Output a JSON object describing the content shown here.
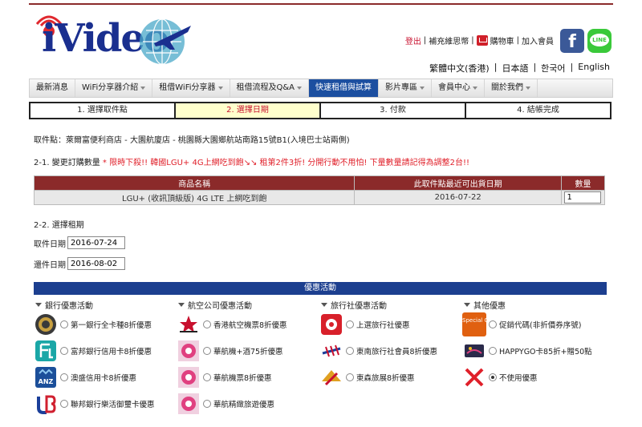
{
  "header": {
    "logo_text": "iVideo",
    "links": {
      "logout": "登出",
      "sep1": "|",
      "recharge": "補充維思幣",
      "sep2": "|",
      "cart": "購物車",
      "sep3": "|",
      "join": "加入會員"
    },
    "line_label": "LINE",
    "fb_label": "f",
    "languages": [
      "繁體中文(香港)",
      "|",
      "日本語",
      "|",
      "한국어",
      "|",
      "English"
    ]
  },
  "nav": {
    "items": [
      {
        "label": "最新消息",
        "caret": false,
        "active": false
      },
      {
        "label": "WiFi分享器介紹",
        "caret": true,
        "active": false
      },
      {
        "label": "租借WiFi分享器",
        "caret": true,
        "active": false
      },
      {
        "label": "租借流程及Q&A",
        "caret": true,
        "active": false
      },
      {
        "label": "快速租借與試算",
        "caret": false,
        "active": true
      },
      {
        "label": "影片專區",
        "caret": true,
        "active": false
      },
      {
        "label": "會員中心",
        "caret": true,
        "active": false
      },
      {
        "label": "關於我們",
        "caret": true,
        "active": false
      }
    ]
  },
  "steps": [
    "1. 選擇取件點",
    "2. 選擇日期",
    "3. 付款",
    "4. 結帳完成"
  ],
  "pickup": "取件點：萊爾富便利商店 - 大園航廈店 - 桃園縣大園鄉航站南路15號B1(入境巴士站兩側)",
  "section1": {
    "title": "2-1. 變更訂購數量",
    "notice": "* 限時下殺!! 韓國LGU+ 4G上網吃到飽↘↘ 租第2件3折! 分開行動不用怕! 下量數量請記得為調整2台!!"
  },
  "order_table": {
    "headers": [
      "商品名稱",
      "此取件點最近可出貨日期",
      "數量"
    ],
    "rows": [
      {
        "product": "LGU+ (收訊頂級版) 4G LTE 上網吃到飽",
        "date": "2016-07-22",
        "qty": "1"
      }
    ]
  },
  "section2": {
    "title": "2-2. 選擇租期",
    "pickup_label": "取件日期",
    "pickup_value": "2016-07-24",
    "return_label": "還件日期",
    "return_value": "2016-08-02"
  },
  "promotions": {
    "header": "優惠活動",
    "columns": [
      {
        "title": "銀行優惠活動",
        "items": [
          {
            "label": "第一銀行全卡種8折優惠",
            "icon": "first-bank-icon",
            "checked": false
          },
          {
            "label": "富邦銀行信用卡8折優惠",
            "icon": "fubon-bank-icon",
            "checked": false
          },
          {
            "label": "澳盛信用卡8折優惠",
            "icon": "anz-bank-icon",
            "checked": false
          },
          {
            "label": "聯邦銀行樂活御璽卡優惠",
            "icon": "union-bank-icon",
            "checked": false
          }
        ]
      },
      {
        "title": "航空公司優惠活動",
        "items": [
          {
            "label": "香港航空機票8折優惠",
            "icon": "hong-kong-airlines-icon",
            "checked": false
          },
          {
            "label": "華航機+酒75折優惠",
            "icon": "china-airlines-icon",
            "checked": false
          },
          {
            "label": "華航機票8折優惠",
            "icon": "china-airlines-icon",
            "checked": false
          },
          {
            "label": "華航精緻旅遊優惠",
            "icon": "china-airlines-icon",
            "checked": false
          }
        ]
      },
      {
        "title": "旅行社優惠活動",
        "items": [
          {
            "label": "上選旅行社優惠",
            "icon": "travel-agency-icon",
            "checked": false
          },
          {
            "label": "東南旅行社會員8折優惠",
            "icon": "jet-travel-icon",
            "checked": false
          },
          {
            "label": "東森旅展8折優惠",
            "icon": "eastern-travel-icon",
            "checked": false
          }
        ]
      },
      {
        "title": "其他優惠",
        "items": [
          {
            "label": "促銷代碼(非折價券序號)",
            "icon": "special-offer-icon",
            "logo_text": "Special Offer",
            "checked": false
          },
          {
            "label": "HAPPYGO卡85折+贈50點",
            "icon": "happygo-card-icon",
            "checked": false
          },
          {
            "label": "不使用優惠",
            "icon": "no-offer-x-icon",
            "checked": true
          }
        ]
      }
    ]
  },
  "colors": {
    "brand_red": "#8b2a2a",
    "nav_active": "#1c4fa0",
    "promo_blue": "#1c3f8f",
    "notice_red": "#e0202a"
  }
}
